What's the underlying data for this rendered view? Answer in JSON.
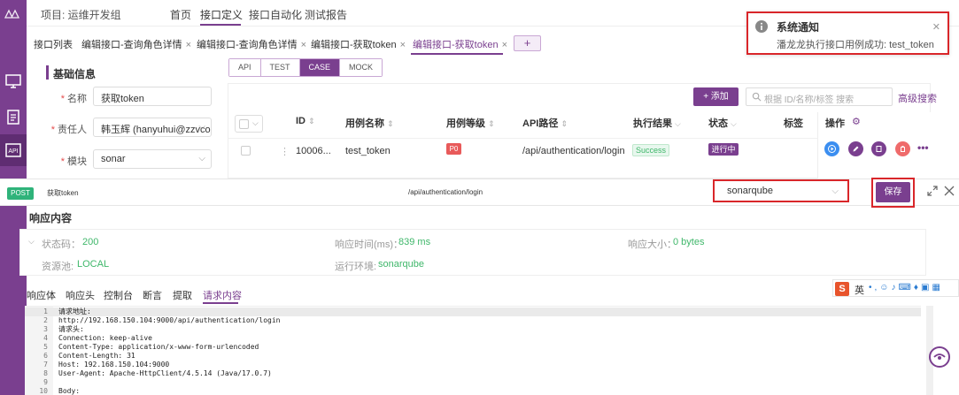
{
  "topnav": {
    "project": "项目: 运维开发组",
    "items": [
      "首页",
      "接口定义",
      "接口自动化",
      "测试报告"
    ],
    "active": "接口定义"
  },
  "tabs": {
    "items": [
      {
        "label": "接口列表",
        "closable": false
      },
      {
        "label": "编辑接口-查询角色详情",
        "closable": true
      },
      {
        "label": "编辑接口-查询角色详情",
        "closable": true
      },
      {
        "label": "编辑接口-获取token",
        "closable": true
      },
      {
        "label": "编辑接口-获取token",
        "closable": true
      }
    ],
    "active_index": 4,
    "add_label": "+"
  },
  "basic": {
    "title": "基础信息",
    "name_label": "名称",
    "name_value": "获取token",
    "owner_label": "责任人",
    "owner_value": "韩玉辉 (hanyuhui@zzvcom",
    "module_label": "模块",
    "module_value": "sonar"
  },
  "mode": {
    "items": [
      "API",
      "TEST",
      "CASE",
      "MOCK"
    ],
    "active": "CASE"
  },
  "toolbar": {
    "add_label": "+ 添加",
    "search_placeholder": "根据 ID/名称/标签 搜索",
    "advanced_search": "高级搜索"
  },
  "table": {
    "headers": {
      "id": "ID",
      "name": "用例名称",
      "level": "用例等级",
      "path": "API路径",
      "result": "执行结果",
      "status": "状态",
      "tags": "标签",
      "ops": "操作"
    },
    "rows": [
      {
        "id": "10006...",
        "name": "test_token",
        "level": "P0",
        "path": "/api/authentication/login",
        "result": "Success",
        "status": "进行中"
      }
    ]
  },
  "notification": {
    "title": "系统通知",
    "message": "潘龙龙执行接口用例成功: test_token"
  },
  "request": {
    "method": "POST",
    "name": "获取token",
    "path": "/api/authentication/login",
    "environment": "sonarqube",
    "save_label": "保存"
  },
  "response": {
    "title": "响应内容",
    "status_label": "状态码：",
    "status_value": "200",
    "time_label": "响应时间(ms)：",
    "time_value": "839 ms",
    "size_label": "响应大小：",
    "size_value": "0 bytes",
    "pool_label": "资源池:",
    "pool_value": "LOCAL",
    "env_label": "运行环境:",
    "env_value": "sonarqube",
    "tabs": [
      "响应体",
      "响应头",
      "控制台",
      "断言",
      "提取",
      "请求内容"
    ],
    "active_tab": "请求内容"
  },
  "code_lines": [
    "请求地址:",
    "http://192.168.150.104:9000/api/authentication/login",
    "请求头:",
    "Connection: keep-alive",
    "Content-Type: application/x-www-form-urlencoded",
    "Content-Length: 31",
    "Host: 192.168.150.104:9000",
    "User-Agent: Apache-HttpClient/4.5.14 (Java/17.0.7)",
    "",
    "Body:"
  ],
  "ime": {
    "logo": "S",
    "lang": "英"
  },
  "colors": {
    "brand": "#7a3f8f",
    "success": "#3fb76a",
    "danger": "#d9262a",
    "post": "#2fb37a"
  }
}
